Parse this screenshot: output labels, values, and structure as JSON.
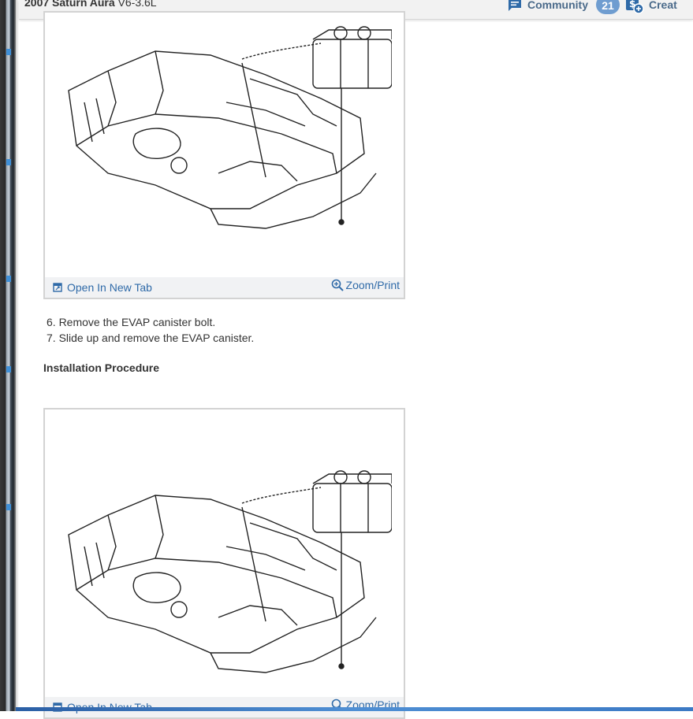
{
  "header": {
    "vehicle_make_model": "2007 Saturn Aura",
    "vehicle_engine": "V6-3.6L",
    "community_label": "Community",
    "community_count": "21",
    "create_label": "Creat"
  },
  "figures": [
    {
      "open_tab_label": "Open In New Tab",
      "zoom_print_label": "Zoom/Print",
      "illustration_icon": "evap-canister-illustration"
    },
    {
      "open_tab_label": "Open In New Tab",
      "zoom_print_label": "Zoom/Print",
      "illustration_icon": "evap-canister-illustration"
    }
  ],
  "steps": [
    "6. Remove the EVAP canister bolt.",
    "7. Slide up and remove the EVAP canister."
  ],
  "installation_heading": "Installation Procedure",
  "colors": {
    "link": "#2f6aa8",
    "badge": "#6f9dd0",
    "header_bg": "#f2f2f2",
    "toolbar_bg": "#f1f2f4"
  }
}
